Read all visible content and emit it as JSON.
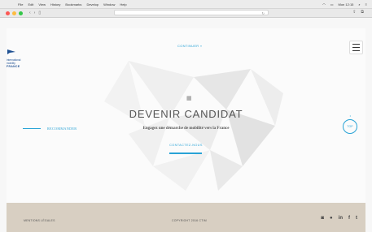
{
  "menubar": {
    "items": [
      "File",
      "Edit",
      "View",
      "History",
      "Bookmarks",
      "Develop",
      "Window",
      "Help"
    ],
    "status": "Mon 12:15"
  },
  "browser": {
    "nav_back": "‹",
    "nav_forward": "›"
  },
  "site": {
    "logo": {
      "line1": "international",
      "line2": "mobility",
      "line3": "FRANCE"
    },
    "continuer": "CONTINUER",
    "hero": {
      "title": "DEVENIR CANDIDAT",
      "subtitle": "Engagez une démarche de mobilité vers la France",
      "contact": "CONTACTEZ-NOUS"
    },
    "recommander": "RECOMMANDER",
    "top_button": "TOP",
    "footer": {
      "legal": "MENTIONS LÉGALES",
      "copyright": "COPYRIGHT 2016 CTIM"
    }
  },
  "colors": {
    "accent": "#29a3d6",
    "footer_bg": "#d8cfc2",
    "logo_blue": "#1d4f91"
  }
}
